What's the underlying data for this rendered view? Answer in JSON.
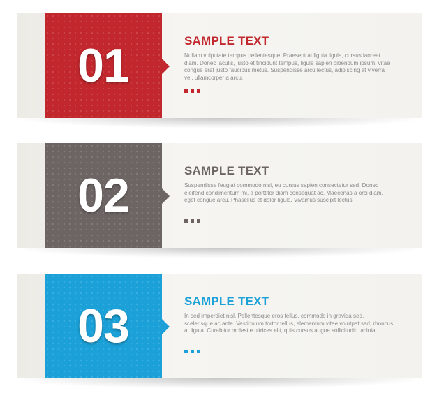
{
  "colors": {
    "red": "#c1272d",
    "gray": "#6d6564",
    "blue": "#1ba1d8",
    "body_text": "#8a8a8a"
  },
  "banners": [
    {
      "number": "01",
      "title": "SAMPLE TEXT",
      "body": "Nullam vulputate tempus pellentesque. Praesent at ligula ligula, cursus laoreet diam. Donec iaculis, justo et tincidunt tempus, ligula sapien bibendum ipsum, vitae congue erat justo faucibus metus. Suspendisse arcu lectus, adipiscing at viverra vel, ullamcorper a arcu.",
      "accent": "#c1272d",
      "dots_icon": "three-dots-icon"
    },
    {
      "number": "02",
      "title": "SAMPLE TEXT",
      "body": "Suspendisse feugiat commodo nisi, eu cursus sapien consectetur sed. Donec eleifend condimentum mi, a porttitor diam consequat ac. Maecenas a orci diam, eget congue arcu. Phasellus et dolor ligula. Vivamus suscipit lectus.",
      "accent": "#6d6564",
      "dots_icon": "three-dots-icon"
    },
    {
      "number": "03",
      "title": "SAMPLE TEXT",
      "body": "In sed imperdiet nisl. Pellentesque eros tellus, commodo in gravida sed, scelerisque ac ante. Vestibulum tortor tellus, elementum vitae volutpat sed, rhoncus at ligula. Curabitur molestie ultrices elit, quis cursus augue sollicitudin lacinia.",
      "accent": "#1ba1d8",
      "dots_icon": "three-dots-icon"
    }
  ]
}
